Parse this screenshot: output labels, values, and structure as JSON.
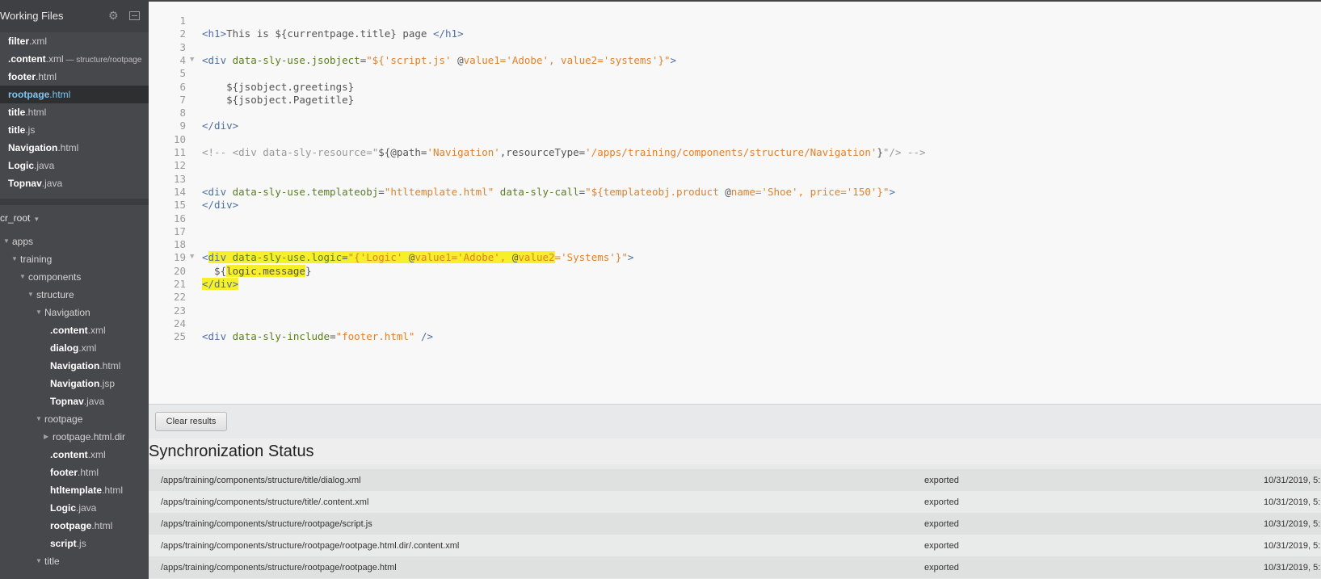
{
  "working_files": {
    "title": "Working Files",
    "items": [
      {
        "name": "filter",
        "ext": ".xml",
        "path": ""
      },
      {
        "name": ".content",
        "ext": ".xml",
        "path": " — structure/rootpage"
      },
      {
        "name": "footer",
        "ext": ".html",
        "path": ""
      },
      {
        "name": "rootpage",
        "ext": ".html",
        "path": "",
        "selected": true
      },
      {
        "name": "title",
        "ext": ".html",
        "path": ""
      },
      {
        "name": "title",
        "ext": ".js",
        "path": ""
      },
      {
        "name": "Navigation",
        "ext": ".html",
        "path": ""
      },
      {
        "name": "Logic",
        "ext": ".java",
        "path": ""
      },
      {
        "name": "Topnav",
        "ext": ".java",
        "path": ""
      }
    ]
  },
  "project": {
    "root_label": "cr_root",
    "tree": [
      {
        "label": "apps",
        "ext": "",
        "type": "folder",
        "depth": 0,
        "open": true
      },
      {
        "label": "training",
        "ext": "",
        "type": "folder",
        "depth": 1,
        "open": true
      },
      {
        "label": "components",
        "ext": "",
        "type": "folder",
        "depth": 2,
        "open": true
      },
      {
        "label": "structure",
        "ext": "",
        "type": "folder",
        "depth": 3,
        "open": true
      },
      {
        "label": "Navigation",
        "ext": "",
        "type": "folder",
        "depth": 4,
        "open": true
      },
      {
        "label": ".content",
        "ext": ".xml",
        "type": "file",
        "depth": 5
      },
      {
        "label": "dialog",
        "ext": ".xml",
        "type": "file",
        "depth": 5
      },
      {
        "label": "Navigation",
        "ext": ".html",
        "type": "file",
        "depth": 5
      },
      {
        "label": "Navigation",
        "ext": ".jsp",
        "type": "file",
        "depth": 5
      },
      {
        "label": "Topnav",
        "ext": ".java",
        "type": "file",
        "depth": 5
      },
      {
        "label": "rootpage",
        "ext": "",
        "type": "folder",
        "depth": 4,
        "open": true
      },
      {
        "label": "rootpage.html.dir",
        "ext": "",
        "type": "folder",
        "depth": 5,
        "open": false
      },
      {
        "label": ".content",
        "ext": ".xml",
        "type": "file",
        "depth": 5
      },
      {
        "label": "footer",
        "ext": ".html",
        "type": "file",
        "depth": 5
      },
      {
        "label": "htltemplate",
        "ext": ".html",
        "type": "file",
        "depth": 5
      },
      {
        "label": "Logic",
        "ext": ".java",
        "type": "file",
        "depth": 5
      },
      {
        "label": "rootpage",
        "ext": ".html",
        "type": "file",
        "depth": 5
      },
      {
        "label": "script",
        "ext": ".js",
        "type": "file",
        "depth": 5
      },
      {
        "label": "title",
        "ext": "",
        "type": "folder",
        "depth": 4,
        "open": true
      }
    ]
  },
  "editor": {
    "lines": [
      {
        "n": "1",
        "fold": false,
        "tokens": []
      },
      {
        "n": "2",
        "fold": false,
        "tokens": [
          {
            "c": "tag",
            "t": "<h1>"
          },
          {
            "c": "txt",
            "t": "This is ${currentpage.title} page "
          },
          {
            "c": "tag",
            "t": "</h1>"
          }
        ]
      },
      {
        "n": "3",
        "fold": false,
        "tokens": []
      },
      {
        "n": "4",
        "fold": true,
        "tokens": [
          {
            "c": "tag",
            "t": "<div "
          },
          {
            "c": "attr",
            "t": "data-sly-use.jsobject"
          },
          {
            "c": "txt",
            "t": "="
          },
          {
            "c": "str",
            "t": "\"${'script.js' "
          },
          {
            "c": "txt",
            "t": "@"
          },
          {
            "c": "str",
            "t": "value1='Adobe', value2='systems'}\""
          },
          {
            "c": "tag",
            "t": ">"
          }
        ]
      },
      {
        "n": "5",
        "fold": false,
        "tokens": []
      },
      {
        "n": "6",
        "fold": false,
        "tokens": [
          {
            "c": "txt",
            "t": "    ${jsobject.greetings}"
          }
        ]
      },
      {
        "n": "7",
        "fold": false,
        "tokens": [
          {
            "c": "txt",
            "t": "    ${jsobject.Pagetitle}"
          }
        ]
      },
      {
        "n": "8",
        "fold": false,
        "tokens": []
      },
      {
        "n": "9",
        "fold": false,
        "tokens": [
          {
            "c": "tag",
            "t": "</div>"
          }
        ]
      },
      {
        "n": "10",
        "fold": false,
        "tokens": []
      },
      {
        "n": "11",
        "fold": false,
        "tokens": [
          {
            "c": "com",
            "t": "<!-- <div data-sly-resource=\""
          },
          {
            "c": "txt",
            "t": "${@path="
          },
          {
            "c": "str",
            "t": "'Navigation'"
          },
          {
            "c": "txt",
            "t": ",resourceType="
          },
          {
            "c": "str",
            "t": "'/apps/training/components/structure/Navigation'"
          },
          {
            "c": "txt",
            "t": "}"
          },
          {
            "c": "com",
            "t": "\"/> -->"
          }
        ]
      },
      {
        "n": "12",
        "fold": false,
        "tokens": []
      },
      {
        "n": "13",
        "fold": false,
        "tokens": []
      },
      {
        "n": "14",
        "fold": false,
        "tokens": [
          {
            "c": "tag",
            "t": "<div "
          },
          {
            "c": "attr",
            "t": "data-sly-use.templateobj"
          },
          {
            "c": "txt",
            "t": "="
          },
          {
            "c": "str",
            "t": "\"htltemplate.html\" "
          },
          {
            "c": "attr",
            "t": "data-sly-call"
          },
          {
            "c": "txt",
            "t": "="
          },
          {
            "c": "str",
            "t": "\"${templateobj.product "
          },
          {
            "c": "txt",
            "t": "@"
          },
          {
            "c": "str",
            "t": "name='Shoe', price='150'}\""
          },
          {
            "c": "tag",
            "t": ">"
          }
        ]
      },
      {
        "n": "15",
        "fold": false,
        "tokens": [
          {
            "c": "tag",
            "t": "</div>"
          }
        ]
      },
      {
        "n": "16",
        "fold": false,
        "tokens": []
      },
      {
        "n": "17",
        "fold": false,
        "tokens": []
      },
      {
        "n": "18",
        "fold": false,
        "tokens": []
      },
      {
        "n": "19",
        "fold": true,
        "tokens": [
          {
            "c": "tag",
            "t": "<"
          },
          {
            "c": "tag hl",
            "t": "div "
          },
          {
            "c": "attr hl",
            "t": "data-sly-use.logic"
          },
          {
            "c": "txt hl",
            "t": "="
          },
          {
            "c": "str hl",
            "t": "\"{'Logic' "
          },
          {
            "c": "txt hl",
            "t": "@"
          },
          {
            "c": "str hl",
            "t": "value1='Adobe', "
          },
          {
            "c": "txt hl",
            "t": "@"
          },
          {
            "c": "str hl",
            "t": "value2"
          },
          {
            "c": "str",
            "t": "='Systems'}\""
          },
          {
            "c": "tag",
            "t": ">"
          }
        ]
      },
      {
        "n": "20",
        "fold": false,
        "tokens": [
          {
            "c": "txt",
            "t": "  ${"
          },
          {
            "c": "txt hl",
            "t": "logic.message"
          },
          {
            "c": "txt",
            "t": "}"
          }
        ]
      },
      {
        "n": "21",
        "fold": false,
        "tokens": [
          {
            "c": "tag hl",
            "t": "</div>"
          }
        ]
      },
      {
        "n": "22",
        "fold": false,
        "tokens": []
      },
      {
        "n": "23",
        "fold": false,
        "tokens": []
      },
      {
        "n": "24",
        "fold": false,
        "tokens": []
      },
      {
        "n": "25",
        "fold": false,
        "tokens": [
          {
            "c": "tag",
            "t": "<div "
          },
          {
            "c": "attr",
            "t": "data-sly-include"
          },
          {
            "c": "txt",
            "t": "="
          },
          {
            "c": "str",
            "t": "\"footer.html\" "
          },
          {
            "c": "tag",
            "t": "/>"
          }
        ]
      }
    ]
  },
  "panel": {
    "clear_label": "Clear results",
    "title": "Synchronization Status",
    "rows": [
      {
        "path": "/apps/training/components/structure/title/dialog.xml",
        "status": "exported",
        "time": "10/31/2019, 5:"
      },
      {
        "path": "/apps/training/components/structure/title/.content.xml",
        "status": "exported",
        "time": "10/31/2019, 5:"
      },
      {
        "path": "/apps/training/components/structure/rootpage/script.js",
        "status": "exported",
        "time": "10/31/2019, 5:"
      },
      {
        "path": "/apps/training/components/structure/rootpage/rootpage.html.dir/.content.xml",
        "status": "exported",
        "time": "10/31/2019, 5:"
      },
      {
        "path": "/apps/training/components/structure/rootpage/rootpage.html",
        "status": "exported",
        "time": "10/31/2019, 5:"
      }
    ]
  }
}
